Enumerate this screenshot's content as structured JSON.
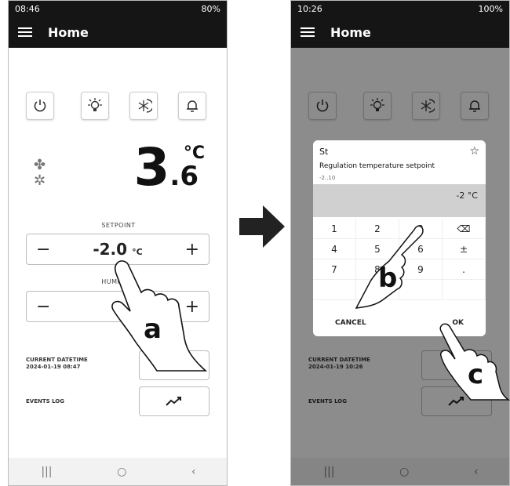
{
  "left": {
    "status": {
      "time": "08:46",
      "battery": "80%"
    },
    "app_title": "Home",
    "temperature": {
      "int": "3",
      "dec": ".6",
      "unit": "°C"
    },
    "setpoint": {
      "label": "SETPOINT",
      "minus": "−",
      "value": "-2.0",
      "unit": "°C",
      "plus": "+"
    },
    "humidity": {
      "label": "HUMIDITY",
      "minus": "−",
      "plus": "+"
    },
    "datetime": {
      "label": "CURRENT DATETIME",
      "value": "2024-01-19 08:47"
    },
    "events": {
      "label": "EVENTS LOG"
    },
    "navbar": {
      "recent": "|||",
      "home": "○",
      "back": "‹"
    }
  },
  "right": {
    "status": {
      "time": "10:26",
      "battery": "100%"
    },
    "app_title": "Home",
    "dialog": {
      "title": "St",
      "description": "Regulation temperature setpoint",
      "range": "-2..10",
      "display": "-2 °C",
      "keys": [
        "1",
        "2",
        "3",
        "⌫",
        "4",
        "5",
        "6",
        "±",
        "7",
        "8",
        "9",
        ".",
        "",
        "0",
        "",
        ""
      ],
      "cancel": "CANCEL",
      "ok": "OK"
    },
    "datetime": {
      "label": "CURRENT DATETIME",
      "value": "2024-01-19 10:26"
    },
    "events": {
      "label": "EVENTS LOG"
    },
    "navbar": {
      "recent": "|||",
      "home": "○",
      "back": "‹"
    }
  },
  "annotations": {
    "a": "a",
    "b": "b",
    "c": "c"
  },
  "icons": [
    "power-icon",
    "light-icon",
    "defrost-icon",
    "bell-icon",
    "fan-icon",
    "snowflake-icon",
    "trend-icon",
    "arrow-right-icon",
    "hand-pointer-icon"
  ]
}
